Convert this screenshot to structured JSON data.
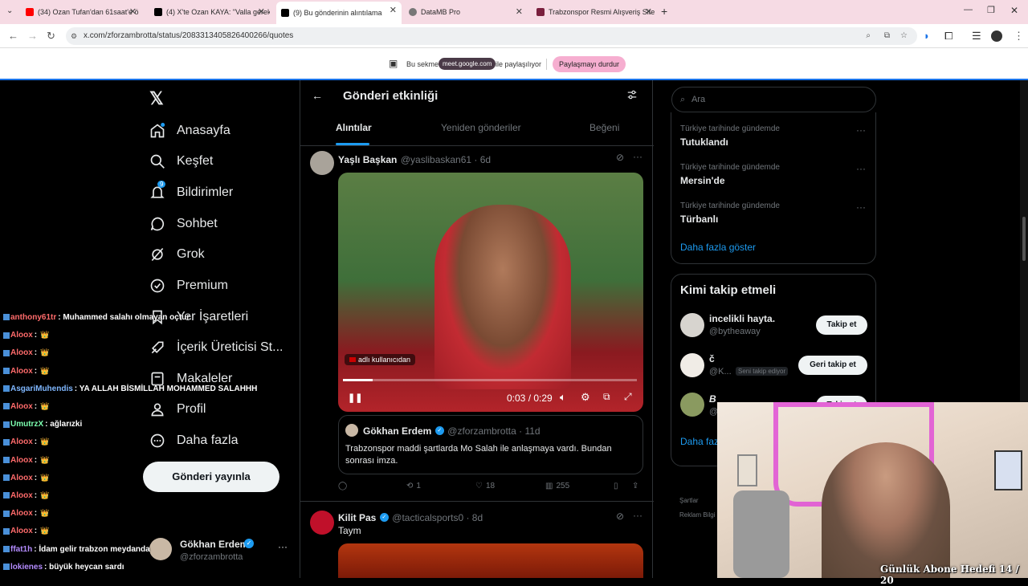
{
  "browser": {
    "tabs": [
      {
        "label": "(34) Ozan Tufan'dan 61saat'e ö",
        "color": "#ff0000"
      },
      {
        "label": "(4) X'te Ozan KAYA: \"Valla gerek",
        "color": "#000000"
      },
      {
        "label": "(9) Bu gönderinin alıntılama",
        "color": "#000000"
      },
      {
        "label": "DataMB Pro",
        "color": "#555555"
      },
      {
        "label": "Trabzonspor Resmi Alışveriş Site",
        "color": "#7a1f3d"
      }
    ],
    "url": "x.com/zforzambrotta/status/2083313405826400266/quotes",
    "share_text": "Bu sekme",
    "share_domain": "meet.google.com",
    "share_after": "ile paylaşılıyor",
    "stop_share": "Paylaşmayı durdur"
  },
  "nav": {
    "items": [
      {
        "label": "Anasayfa",
        "icon": "home-icon"
      },
      {
        "label": "Keşfet",
        "icon": "search-icon"
      },
      {
        "label": "Bildirimler",
        "icon": "bell-icon"
      },
      {
        "label": "Sohbet",
        "icon": "chat-icon"
      },
      {
        "label": "Grok",
        "icon": "grok-icon"
      },
      {
        "label": "Premium",
        "icon": "premium-icon"
      },
      {
        "label": "Yer İşaretleri",
        "icon": "bookmark-icon"
      },
      {
        "label": "İçerik Üreticisi St...",
        "icon": "rocket-icon"
      },
      {
        "label": "Makaleler",
        "icon": "article-icon"
      },
      {
        "label": "Profil",
        "icon": "person-icon"
      },
      {
        "label": "Daha fazla",
        "icon": "more-circle-icon"
      }
    ],
    "notif_count": "9",
    "post_button": "Gönderi yayınla",
    "account": {
      "name": "Gökhan Erdem",
      "handle": "@zforzambrotta"
    }
  },
  "chat": [
    {
      "user": "anthony61tr",
      "msg": ": Muhammed salahı olmayan oçtur.",
      "user_color": "#ff6b6b"
    },
    {
      "user": "Aloox",
      "msg": ":",
      "user_color": "#ff6b6b",
      "crown": "👑"
    },
    {
      "user": "Aloox",
      "msg": ":",
      "user_color": "#ff6b6b",
      "crown": "👑"
    },
    {
      "user": "Aloox",
      "msg": ":",
      "user_color": "#ff6b6b",
      "crown": "👑"
    },
    {
      "user": "AsgariMuhendis",
      "msg": ": YA ALLAH BİSMİLLAH MOHAMMED SALAHHH",
      "user_color": "#7fb7ff"
    },
    {
      "user": "Aloox",
      "msg": ":",
      "user_color": "#ff6b6b",
      "crown": "👑"
    },
    {
      "user": "UmutrzX",
      "msg": ": ağlarızki",
      "user_color": "#7cffb0"
    },
    {
      "user": "Aloox",
      "msg": ":",
      "user_color": "#ff6b6b",
      "crown": "👑"
    },
    {
      "user": "Aloox",
      "msg": ":",
      "user_color": "#ff6b6b",
      "crown": "👑"
    },
    {
      "user": "Aloox",
      "msg": ":",
      "user_color": "#ff6b6b",
      "crown": "👑"
    },
    {
      "user": "Aloox",
      "msg": ":",
      "user_color": "#ff6b6b",
      "crown": "👑"
    },
    {
      "user": "Aloox",
      "msg": ":",
      "user_color": "#ff6b6b",
      "crown": "👑"
    },
    {
      "user": "Aloox",
      "msg": ":",
      "user_color": "#ff6b6b",
      "crown": "👑"
    },
    {
      "user": "ffat1h",
      "msg": ": İdam gelir trabzon meydanda",
      "user_color": "#b48cff"
    },
    {
      "user": "lokienes",
      "msg": ": büyük heycan sardı",
      "user_color": "#b48cff"
    }
  ],
  "center": {
    "title": "Gönderi etkinliği",
    "tabs": [
      "Alıntılar",
      "Yeniden gönderiler",
      "Beğeni"
    ],
    "post1": {
      "name": "Yaşlı Başkan",
      "handle": "@yaslibaskan61 · 6d",
      "video_user_tag": "adlı kullanıcıdan",
      "video_time": "0:03 / 0:29",
      "video_progress": 0.1,
      "quote": {
        "name": "Gökhan Erdem",
        "handle": "@zforzambrotta · 11d",
        "text": "Trabzonspor maddi şartlarda Mo Salah ile anlaşmaya vardı. Bundan sonrası imza."
      },
      "actions": {
        "replies": "",
        "reposts": "1",
        "likes": "18",
        "views": "255"
      }
    },
    "post2": {
      "name": "Kilit Pas",
      "handle": "@tacticalsports0 · 8d",
      "text": "Taym"
    }
  },
  "right": {
    "search_placeholder": "Ara",
    "trends": [
      {
        "sub": "Türkiye tarihinde gündemde",
        "title": "Tutuklandı"
      },
      {
        "sub": "Türkiye tarihinde gündemde",
        "title": "Mersin'de"
      },
      {
        "sub": "Türkiye tarihinde gündemde",
        "title": "Türbanlı"
      }
    ],
    "show_more": "Daha fazla göster",
    "follow_title": "Kimi takip etmeli",
    "follow": [
      {
        "name": "incelikli hayta.",
        "handle": "@bytheaway",
        "button": "Takip et",
        "badge": ""
      },
      {
        "name": "č",
        "handle": "@K...",
        "button": "Geri takip et",
        "badge": "Seni takip ediyor"
      },
      {
        "name": "B",
        "handle": "@",
        "button": "Takip et",
        "badge": ""
      }
    ],
    "show_more2": "Daha faz",
    "footer": [
      "Şartlar",
      "Reklam Bilgi"
    ]
  },
  "overlay": {
    "goal": "Günlük Abone Hedefi 14 / 20"
  },
  "colors": {
    "accent": "#1d9bf0",
    "verified": "#1d9bf0",
    "stop_share": "#f6aed0",
    "tabbar": "#f6dbe4"
  }
}
